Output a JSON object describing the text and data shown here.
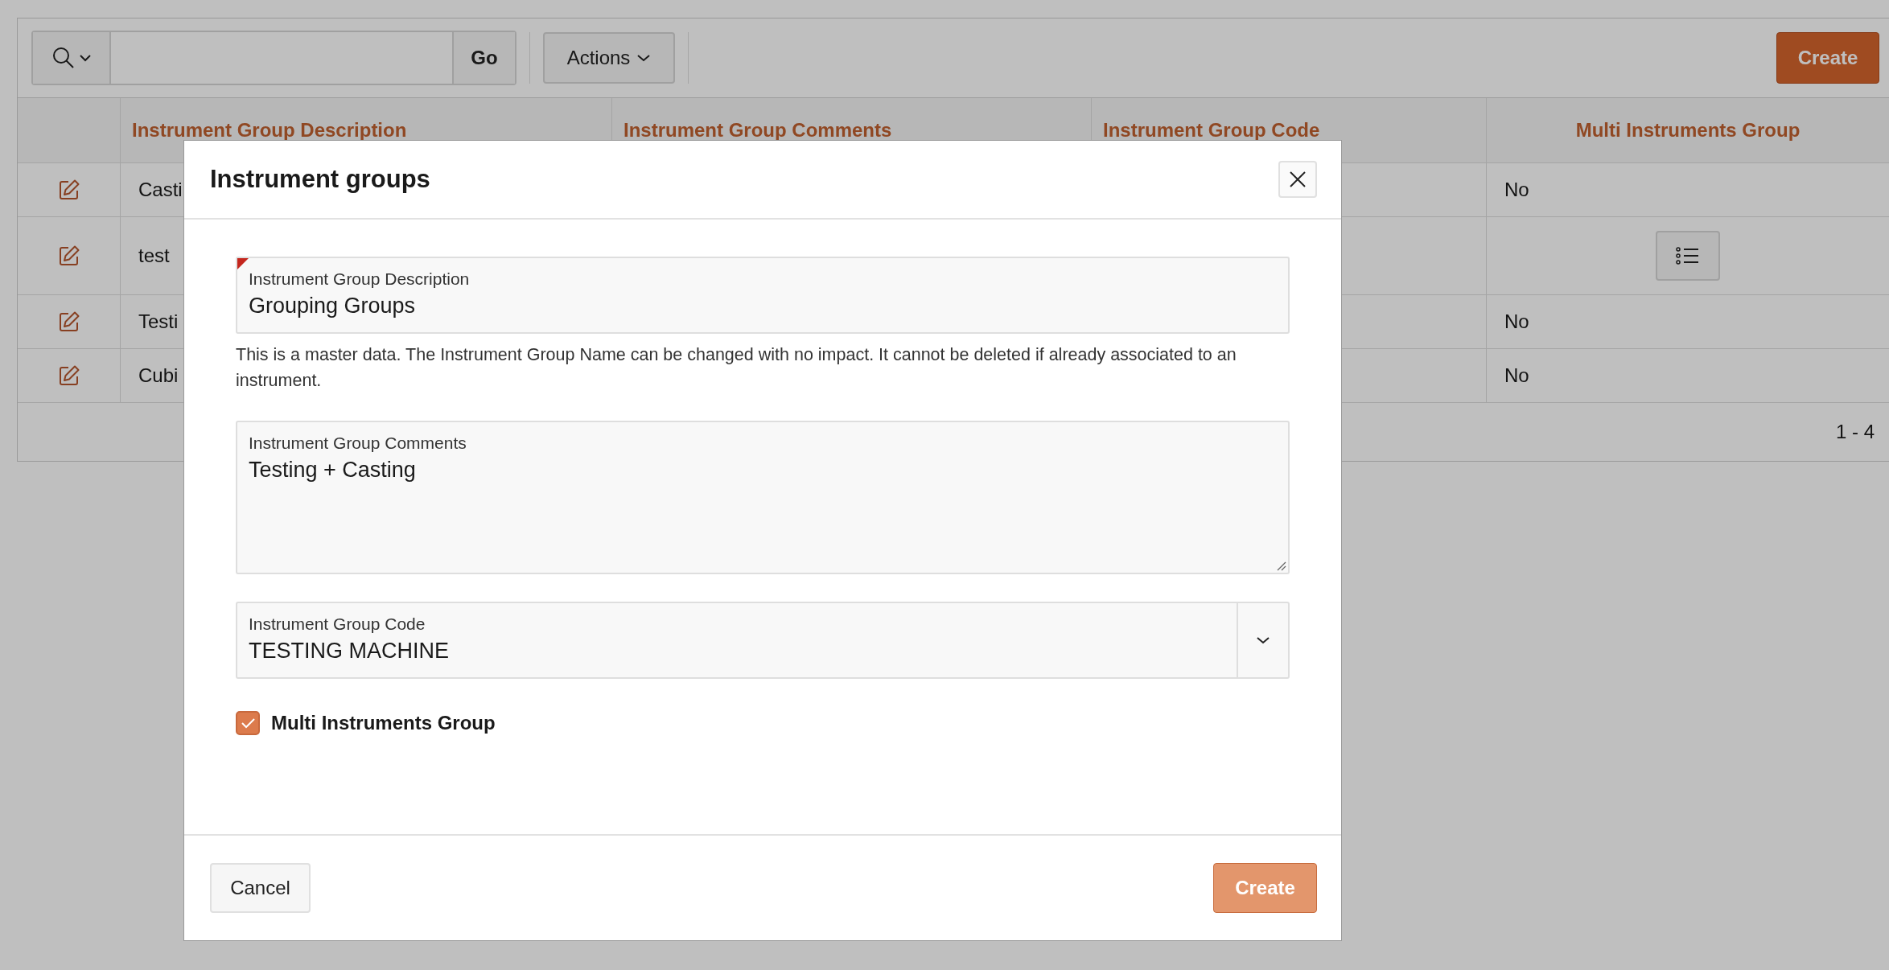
{
  "toolbar": {
    "go_button": "Go",
    "actions_button": "Actions",
    "create_button": "Create"
  },
  "table": {
    "columns": [
      "Instrument Group Description",
      "Instrument Group Comments",
      "Instrument Group Code",
      "Multi Instruments Group"
    ],
    "rows": [
      {
        "description": "Casti",
        "kind": "text",
        "multi_instruments_group": "No"
      },
      {
        "description": "test",
        "kind": "list"
      },
      {
        "description": "Testi",
        "kind": "text",
        "multi_instruments_group": "No"
      },
      {
        "description": "Cubi",
        "kind": "text",
        "multi_instruments_group": "No"
      }
    ],
    "pagination": "1 - 4"
  },
  "dialog": {
    "title": "Instrument groups",
    "fields": [
      {
        "kind": "text",
        "label": "Instrument Group Description",
        "value": "Grouping Groups",
        "required": true,
        "help": "This is a master data. The Instrument Group Name can be changed with no impact. It cannot be deleted if already associated to an instrument."
      },
      {
        "kind": "textarea",
        "label": "Instrument Group Comments",
        "value": "Testing + Casting",
        "required": false
      },
      {
        "kind": "select",
        "label": "Instrument Group Code",
        "value": "TESTING MACHINE",
        "required": false
      }
    ],
    "checkbox": {
      "label": "Multi Instruments Group",
      "checked": true
    },
    "buttons": [
      {
        "label": "Cancel",
        "kind": "secondary"
      },
      {
        "label": "Create",
        "kind": "primary"
      }
    ]
  }
}
